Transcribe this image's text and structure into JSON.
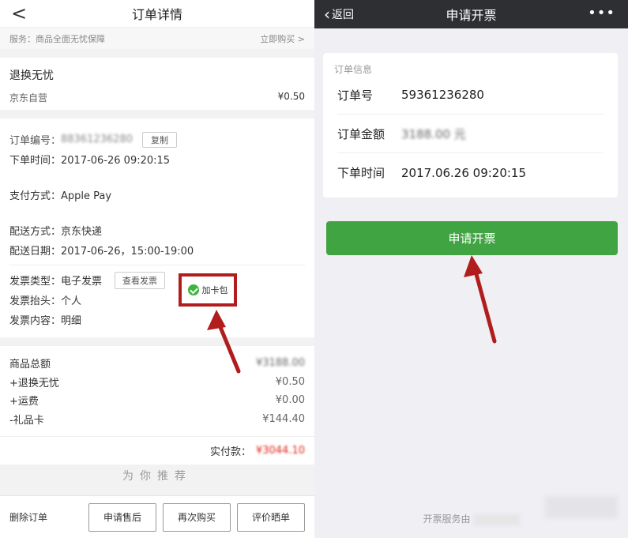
{
  "left": {
    "nav": {
      "back": "<",
      "title": "订单详情"
    },
    "service": {
      "text": "服务：商品全面无忧保障",
      "action": "立即购买 >"
    },
    "insurance": {
      "title": "退换无忧",
      "seller": "京东自营",
      "price": "¥0.50"
    },
    "order": {
      "number_label": "订单编号：",
      "number_value": "88361236280",
      "copy_label": "复制",
      "time": "下单时间：2017-06-26 09:20:15",
      "payment": "支付方式：Apple Pay",
      "delivery": "配送方式：京东快递",
      "delivery_date": "配送日期：2017-06-26，15:00-19:00",
      "invoice_type": "发票类型：电子发票",
      "view_invoice": "查看发票",
      "add_card": "加卡包",
      "invoice_title": "发票抬头：个人",
      "invoice_content": "发票内容：明细"
    },
    "totals": [
      {
        "label": "商品总额",
        "value": "¥3188.00",
        "blurred": true
      },
      {
        "label": "+退换无忧",
        "value": "¥0.50"
      },
      {
        "label": "+运费",
        "value": "¥0.00"
      },
      {
        "label": "-礼品卡",
        "value": "¥144.40"
      }
    ],
    "paid": {
      "label": "实付款：",
      "value": "¥3044.10"
    },
    "recommend": "为你推荐",
    "toolbar": {
      "delete": "删除订单",
      "after_sale": "申请售后",
      "rebuy": "再次购买",
      "review": "评价晒单"
    }
  },
  "right": {
    "nav": {
      "back": "返回",
      "title": "申请开票",
      "more": "•••"
    },
    "card": {
      "title": "订单信息",
      "rows": [
        {
          "key": "订单号",
          "value": "59361236280"
        },
        {
          "key": "订单金额",
          "value": "3188.00 元"
        },
        {
          "key": "下单时间",
          "value": "2017.06.26 09:20:15"
        }
      ]
    },
    "apply_button": "申请开票",
    "footer": "开票服务由"
  },
  "colors": {
    "highlight_red": "#b11d1d",
    "wechat_green": "#41a443",
    "dark_nav": "#2e2f33"
  },
  "icons": {
    "left_back": "chevron-left-icon",
    "right_back": "chevron-left-icon",
    "more": "more-dots-icon",
    "wechat": "wechat-icon"
  }
}
